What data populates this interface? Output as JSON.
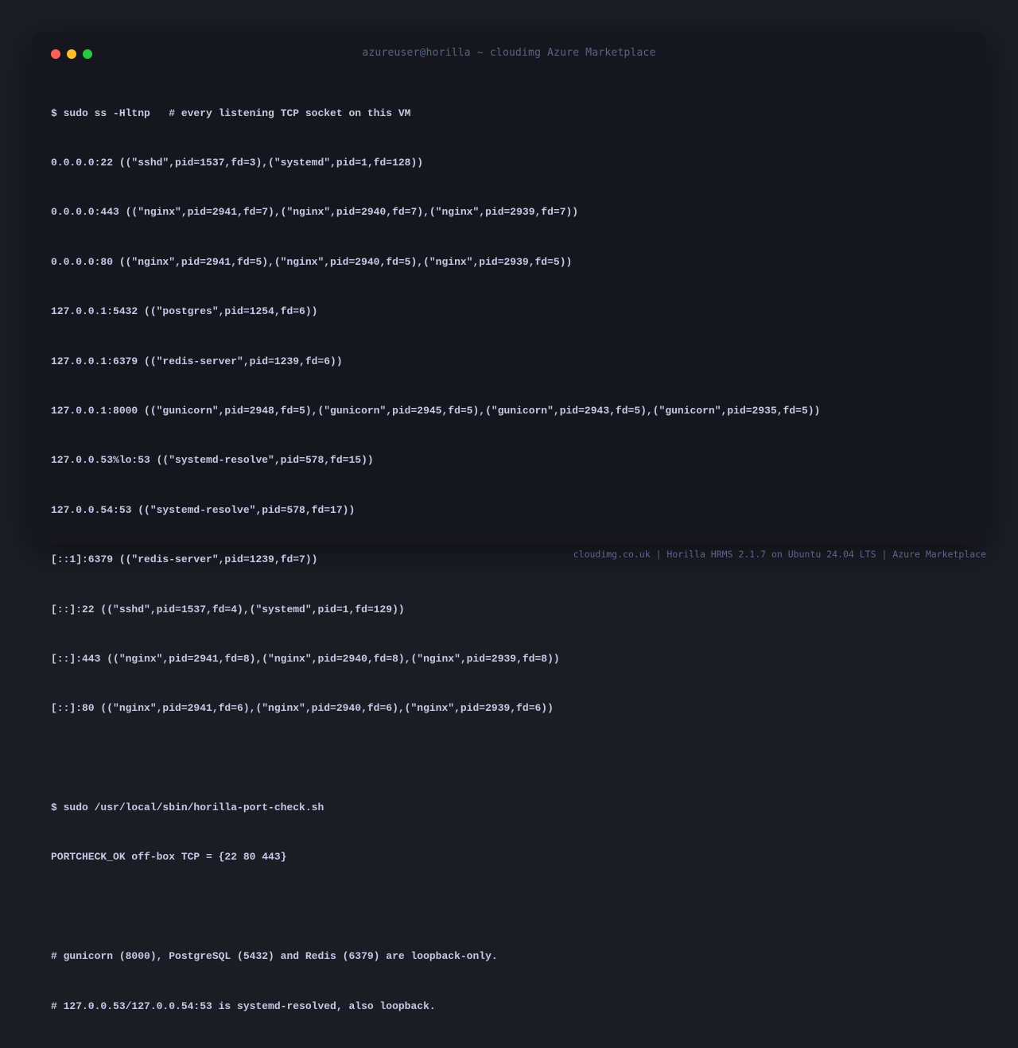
{
  "window": {
    "title": "azureuser@horilla ~ cloudimg Azure Marketplace"
  },
  "terminal": {
    "command1": "$ sudo ss -Hltnp   # every listening TCP socket on this VM",
    "sockets": [
      "0.0.0.0:22 ((\"sshd\",pid=1537,fd=3),(\"systemd\",pid=1,fd=128))",
      "0.0.0.0:443 ((\"nginx\",pid=2941,fd=7),(\"nginx\",pid=2940,fd=7),(\"nginx\",pid=2939,fd=7))",
      "0.0.0.0:80 ((\"nginx\",pid=2941,fd=5),(\"nginx\",pid=2940,fd=5),(\"nginx\",pid=2939,fd=5))",
      "127.0.0.1:5432 ((\"postgres\",pid=1254,fd=6))",
      "127.0.0.1:6379 ((\"redis-server\",pid=1239,fd=6))",
      "127.0.0.1:8000 ((\"gunicorn\",pid=2948,fd=5),(\"gunicorn\",pid=2945,fd=5),(\"gunicorn\",pid=2943,fd=5),(\"gunicorn\",pid=2935,fd=5))",
      "127.0.0.53%lo:53 ((\"systemd-resolve\",pid=578,fd=15))",
      "127.0.0.54:53 ((\"systemd-resolve\",pid=578,fd=17))",
      "[::1]:6379 ((\"redis-server\",pid=1239,fd=7))",
      "[::]:22 ((\"sshd\",pid=1537,fd=4),(\"systemd\",pid=1,fd=129))",
      "[::]:443 ((\"nginx\",pid=2941,fd=8),(\"nginx\",pid=2940,fd=8),(\"nginx\",pid=2939,fd=8))",
      "[::]:80 ((\"nginx\",pid=2941,fd=6),(\"nginx\",pid=2940,fd=6),(\"nginx\",pid=2939,fd=6))"
    ],
    "command2": "$ sudo /usr/local/sbin/horilla-port-check.sh",
    "portcheck_result": "PORTCHECK_OK off-box TCP = {22 80 443}",
    "note1": "# gunicorn (8000), PostgreSQL (5432) and Redis (6379) are loopback-only.",
    "note2": "# 127.0.0.53/127.0.0.54:53 is systemd-resolved, also loopback."
  },
  "footer": {
    "text": "cloudimg.co.uk | Horilla HRMS 2.1.7 on Ubuntu 24.04 LTS | Azure Marketplace"
  },
  "colors": {
    "background": "#1c1c25",
    "window": "#16161e",
    "text": "#c4cae6",
    "muted": "#5a6488",
    "close": "#ff5f57",
    "minimize": "#febc2e",
    "maximize": "#28c840"
  }
}
